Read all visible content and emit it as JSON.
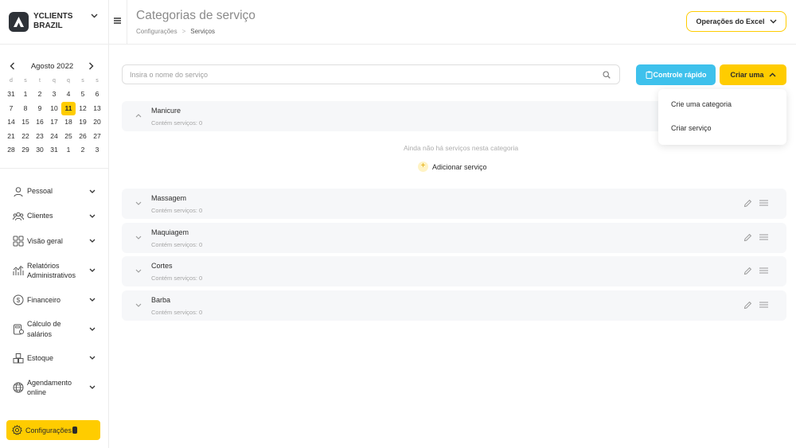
{
  "brand": {
    "name": "YCLIENTS BRAZIL"
  },
  "calendar": {
    "month": "Agosto 2022",
    "weekdays": [
      "d",
      "s",
      "t",
      "q",
      "q",
      "s",
      "s"
    ],
    "days": [
      "31",
      "1",
      "2",
      "3",
      "4",
      "5",
      "6",
      "7",
      "8",
      "9",
      "10",
      "11",
      "12",
      "13",
      "14",
      "15",
      "16",
      "17",
      "18",
      "19",
      "20",
      "21",
      "22",
      "23",
      "24",
      "25",
      "26",
      "27",
      "28",
      "29",
      "30",
      "31",
      "1",
      "2",
      "3"
    ],
    "today": "11"
  },
  "nav": {
    "items": [
      {
        "label": "Pessoal",
        "icon": "person-icon"
      },
      {
        "label": "Clientes",
        "icon": "clients-icon"
      },
      {
        "label": "Visão geral",
        "icon": "grid-icon"
      },
      {
        "label": "Relatórios Administrativos",
        "icon": "chart-icon"
      },
      {
        "label": "Financeiro",
        "icon": "dollar-icon"
      },
      {
        "label": "Cálculo de salários",
        "icon": "calculator-icon"
      },
      {
        "label": "Estoque",
        "icon": "boxes-icon"
      },
      {
        "label": "Agendamento online",
        "icon": "globe-icon"
      }
    ],
    "config_label": "Configurações"
  },
  "header": {
    "title": "Categorias de serviço",
    "breadcrumb": [
      "Configurações",
      "Serviços"
    ],
    "excel_label": "Operações do Excel"
  },
  "search": {
    "placeholder": "Insira o nome do serviço"
  },
  "actions": {
    "quick_label": "Controle rápido",
    "create_label": "Criar uma",
    "dropdown": [
      "Crie uma categoria",
      "Criar serviço"
    ]
  },
  "categories": [
    {
      "name": "Manicure",
      "count": "Contém serviços: 0",
      "expanded": true
    },
    {
      "name": "Massagem",
      "count": "Contém serviços: 0"
    },
    {
      "name": "Maquiagem",
      "count": "Contém serviços: 0"
    },
    {
      "name": "Cortes",
      "count": "Contém serviços: 0"
    },
    {
      "name": "Barba",
      "count": "Contém serviços: 0"
    }
  ],
  "empty_state": {
    "message": "Ainda não há serviços nesta categoria",
    "add_label": "Adicionar serviço"
  },
  "colors": {
    "accent": "#ffcc00",
    "quick": "#3ec1ec",
    "row_bg": "#f6f7f9"
  }
}
